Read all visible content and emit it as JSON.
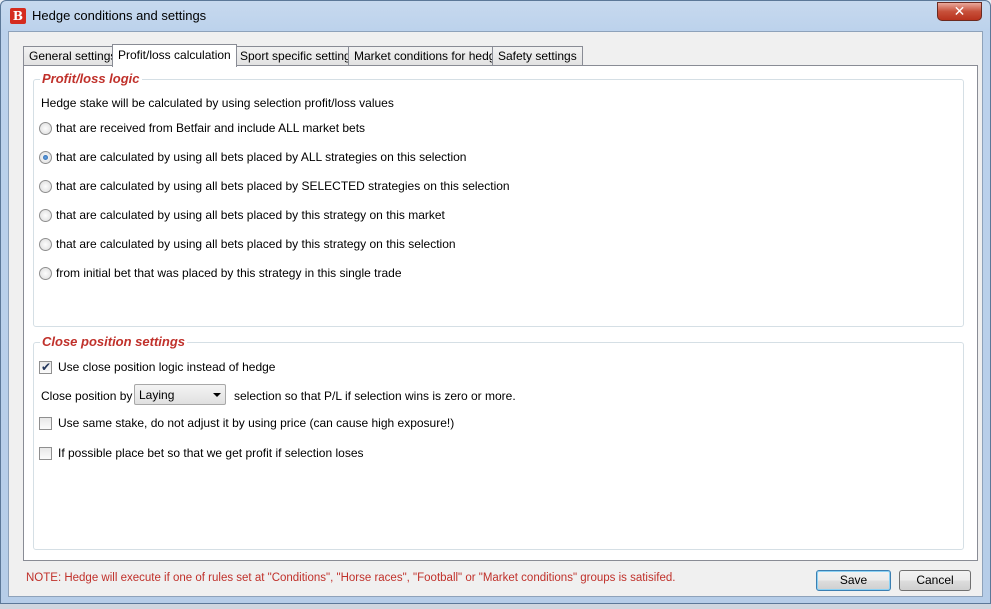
{
  "window": {
    "title": "Hedge conditions and settings",
    "icon_letter": "B",
    "close_glyph": "✕"
  },
  "tabs": [
    {
      "label": "General settings",
      "active": false
    },
    {
      "label": "Profit/loss calculation",
      "active": true
    },
    {
      "label": "Sport specific settings",
      "active": false
    },
    {
      "label": "Market conditions for hedge",
      "active": false
    },
    {
      "label": "Safety settings",
      "active": false
    }
  ],
  "profit_loss": {
    "title": "Profit/loss logic",
    "intro": "Hedge stake will be calculated by using selection profit/loss values",
    "options": [
      {
        "label": "that are received from Betfair and include ALL market bets",
        "selected": false
      },
      {
        "label": "that are calculated by using all bets placed by ALL strategies on this selection",
        "selected": true
      },
      {
        "label": "that are calculated by using all bets placed by SELECTED strategies on this selection",
        "selected": false
      },
      {
        "label": "that are calculated by using all bets placed by this strategy on this market",
        "selected": false
      },
      {
        "label": "that are calculated by using all bets placed by this strategy on this selection",
        "selected": false
      },
      {
        "label": "from initial bet that was placed by this strategy in this single trade",
        "selected": false
      }
    ]
  },
  "close_position": {
    "title": "Close position settings",
    "use_close_logic": {
      "label": "Use close position logic instead of hedge",
      "checked": true
    },
    "close_by_label": "Close position by",
    "close_by_value": "Laying",
    "close_by_suffix": "selection so that P/L if selection wins is zero or more.",
    "same_stake": {
      "label": "Use same stake, do not adjust it by using price (can cause high exposure!)",
      "checked": false
    },
    "profit_if_loses": {
      "label": "If possible place bet so that we get profit if selection loses",
      "checked": false
    }
  },
  "footer": {
    "note": "NOTE: Hedge will execute if one of rules set at \"Conditions\", \"Horse races\", \"Football\" or \"Market conditions\" groups is satisifed.",
    "save_label": "Save",
    "cancel_label": "Cancel"
  },
  "colors": {
    "accent_red": "#c0312b",
    "title_bar": "#bcd2ec"
  }
}
